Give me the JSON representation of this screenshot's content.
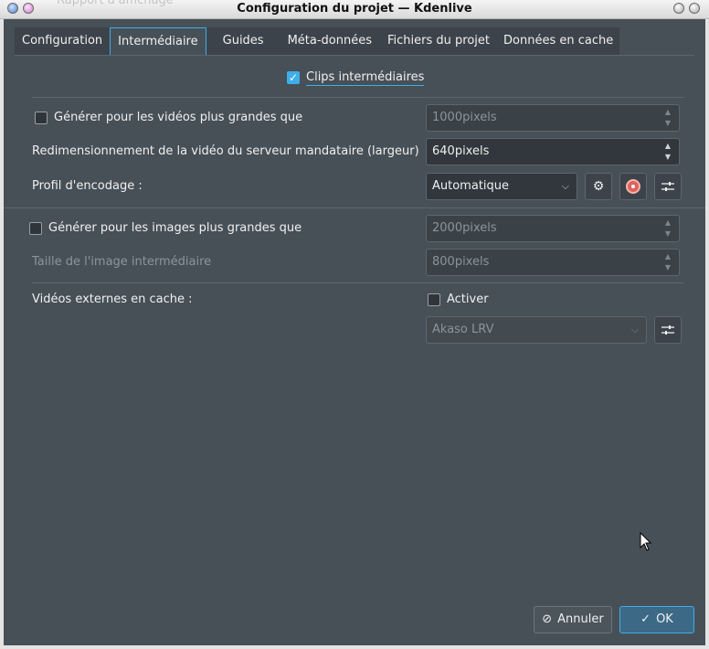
{
  "window": {
    "title": "Configuration du projet — Kdenlive",
    "background_title": "Rapport d'affichage"
  },
  "tabs": [
    {
      "label": "Configuration",
      "active": false
    },
    {
      "label": "Intermédiaire",
      "active": true
    },
    {
      "label": "Guides",
      "active": false
    },
    {
      "label": "Méta-données",
      "active": false
    },
    {
      "label": "Fichiers du projet",
      "active": false
    },
    {
      "label": "Données en cache",
      "active": false
    }
  ],
  "proxy": {
    "clips_label": "Clips intermédiaires",
    "clips_checked": true,
    "videos_label": "Générer pour les vidéos plus grandes que",
    "videos_checked": false,
    "videos_value": "1000pixels",
    "resize_label": "Redimensionnement de la vidéo du serveur mandataire (largeur)",
    "resize_value": "640pixels",
    "profile_label": "Profil d'encodage :",
    "profile_value": "Automatique",
    "images_label": "Générer pour les images plus grandes que",
    "images_checked": false,
    "images_value": "2000pixels",
    "image_size_label": "Taille de l'image intermédiaire",
    "image_size_value": "800pixels",
    "external_label": "Vidéos externes en cache :",
    "external_activate_label": "Activer",
    "external_checked": false,
    "external_profile_value": "Akaso LRV"
  },
  "buttons": {
    "cancel": "Annuler",
    "ok": "OK"
  },
  "icons": {
    "settings": "gear-icon",
    "check_profile": "target-icon",
    "edit_profile": "sliders-icon",
    "cancel": "cancel-icon",
    "ok": "check-icon"
  },
  "colors": {
    "accent": "#3daee9",
    "panel_bg": "#475057"
  }
}
